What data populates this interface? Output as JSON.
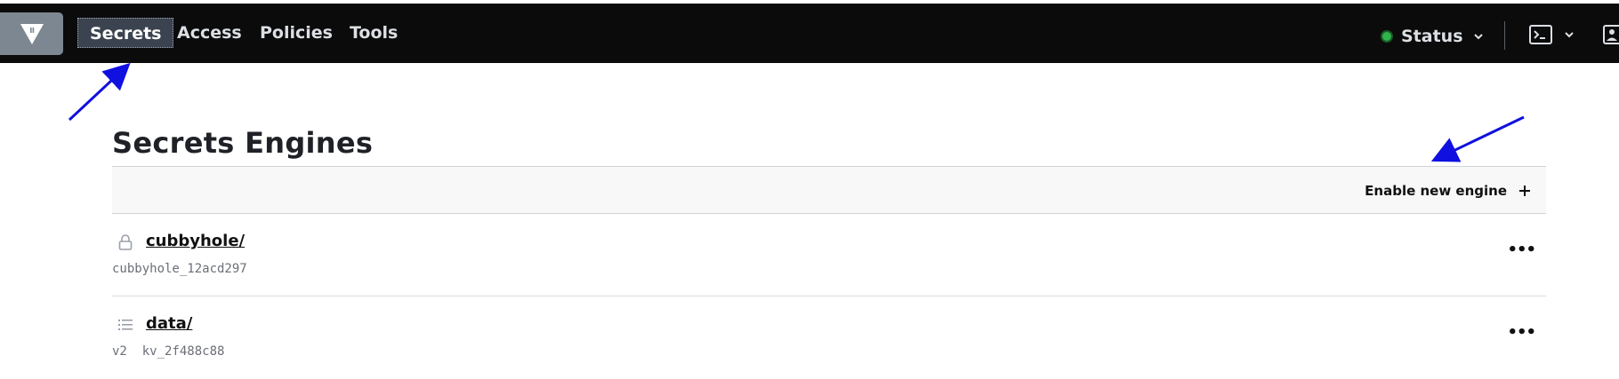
{
  "nav": {
    "logo_icon": "vault-logo-icon",
    "items": [
      {
        "label": "Secrets",
        "active": true
      },
      {
        "label": "Access"
      },
      {
        "label": "Policies"
      },
      {
        "label": "Tools"
      }
    ],
    "status_label": "Status",
    "status_color": "#2fb34a",
    "console_icon": "terminal-icon",
    "user_icon": "user-icon"
  },
  "page": {
    "title": "Secrets Engines"
  },
  "toolbar": {
    "enable_label": "Enable new engine",
    "enable_icon": "plus-icon"
  },
  "engines": [
    {
      "name": "cubbyhole/",
      "detail": "cubbyhole_12acd297",
      "icon": "lock-icon"
    },
    {
      "name": "data/",
      "detail": "v2  kv_2f488c88",
      "icon": "list-icon"
    }
  ],
  "annotations": {
    "arrow_color": "#1010e0"
  }
}
